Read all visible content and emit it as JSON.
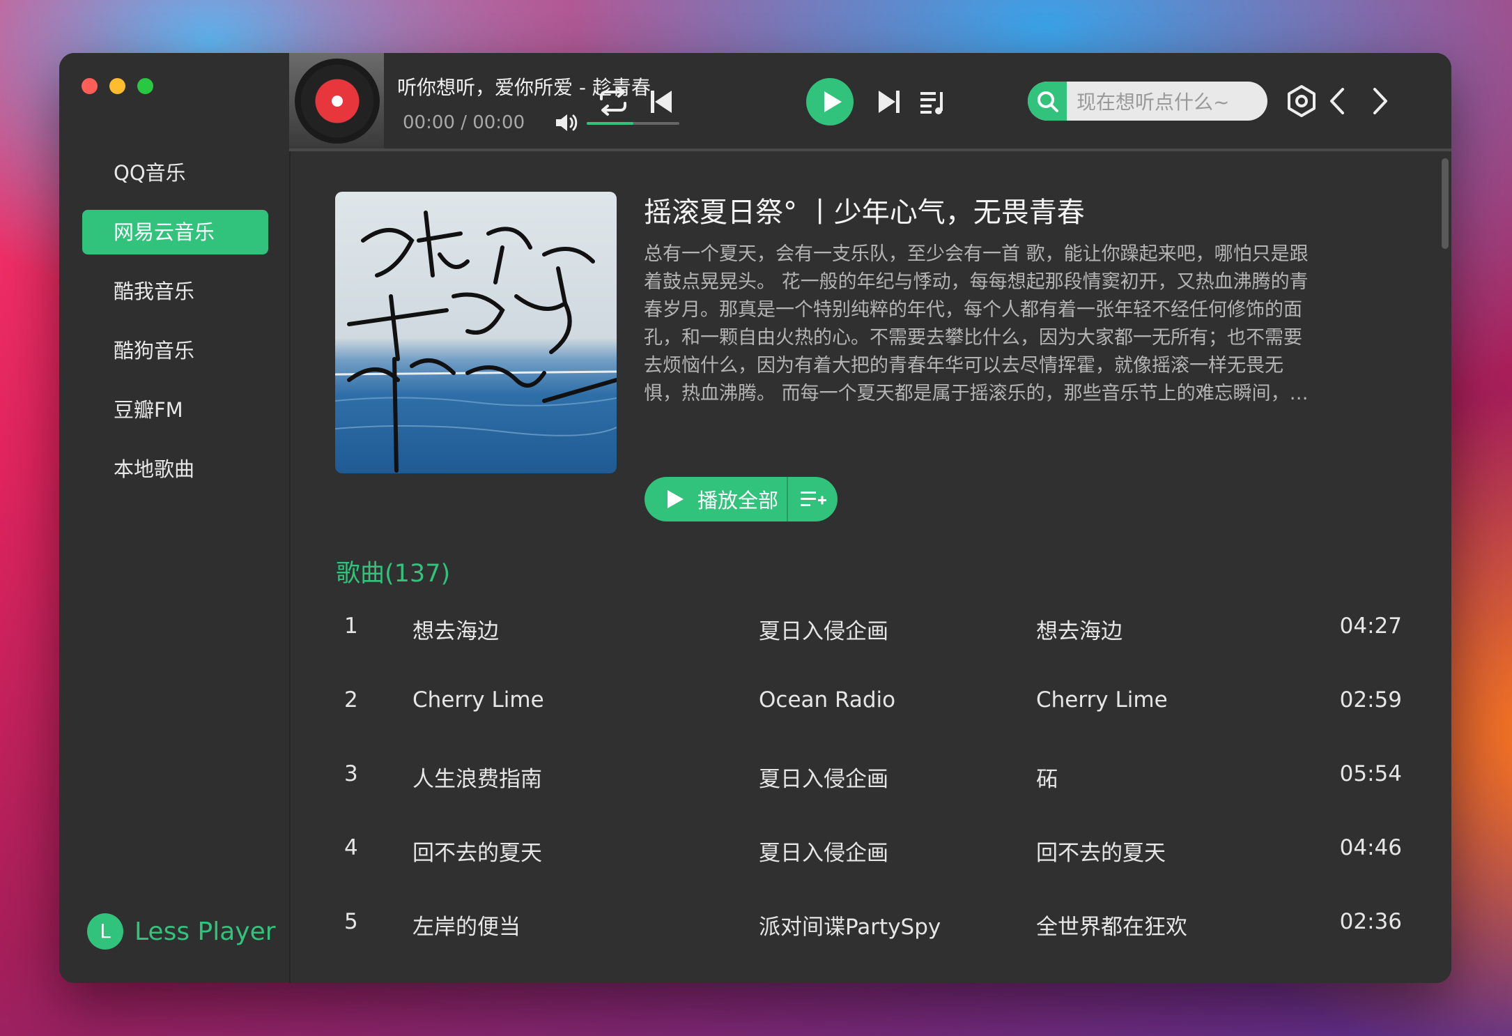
{
  "player": {
    "title": "听你想听，爱你所爱 - 趁青春",
    "time": "00:00 / 00:00",
    "volume_percent": 50
  },
  "search": {
    "placeholder": "现在想听点什么~"
  },
  "sidebar": {
    "items": [
      {
        "label": "QQ音乐"
      },
      {
        "label": "网易云音乐"
      },
      {
        "label": "酷我音乐"
      },
      {
        "label": "酷狗音乐"
      },
      {
        "label": "豆瓣FM"
      },
      {
        "label": "本地歌曲"
      }
    ],
    "active_index": 1,
    "brand": {
      "logo_letter": "L",
      "name": "Less Player"
    }
  },
  "playlist": {
    "title": "摇滚夏日祭° 丨少年心气，无畏青春",
    "description_lines": [
      "总有一个夏天，会有一支乐队，至少会有一首 歌，能让你躁起来吧，哪怕只是跟",
      "着鼓点晃晃头。 花一般的年纪与悸动，每每想起那段情窦初开，又热血沸腾的青",
      "春岁月。那真是一个特别纯粹的年代，每个人都有着一张年轻不经任何修饰的面",
      "孔，和一颗自由火热的心。不需要去攀比什么，因为大家都一无所有；也不需要",
      "去烦恼什么，因为有着大把的青春年华可以去尽情挥霍，就像摇滚一样无畏无",
      "惧，热血沸腾。 而每一个夏天都是属于摇滚乐的，那些音乐节上的难忘瞬间，…"
    ],
    "play_all_label": "播放全部",
    "songs_header": "歌曲(137)",
    "songs": [
      {
        "index": "1",
        "name": "想去海边",
        "artist": "夏日入侵企画",
        "album": "想去海边",
        "duration": "04:27"
      },
      {
        "index": "2",
        "name": "Cherry Lime",
        "artist": "Ocean Radio",
        "album": "Cherry Lime",
        "duration": "02:59"
      },
      {
        "index": "3",
        "name": "人生浪费指南",
        "artist": "夏日入侵企画",
        "album": "砳",
        "duration": "05:54"
      },
      {
        "index": "4",
        "name": "回不去的夏天",
        "artist": "夏日入侵企画",
        "album": "回不去的夏天",
        "duration": "04:46"
      },
      {
        "index": "5",
        "name": "左岸的便当",
        "artist": "派对间谍PartySpy",
        "album": "全世界都在狂欢",
        "duration": "02:36"
      }
    ]
  },
  "colors": {
    "accent": "#31c27c",
    "window_bg": "#303030",
    "text": "#e6e6e6",
    "muted": "#b4b4b4"
  },
  "icons": [
    "repeat-icon",
    "previous-icon",
    "play-icon",
    "next-icon",
    "playlist-icon",
    "search-icon",
    "settings-icon",
    "back-icon",
    "forward-icon",
    "volume-icon",
    "add-to-list-icon"
  ]
}
